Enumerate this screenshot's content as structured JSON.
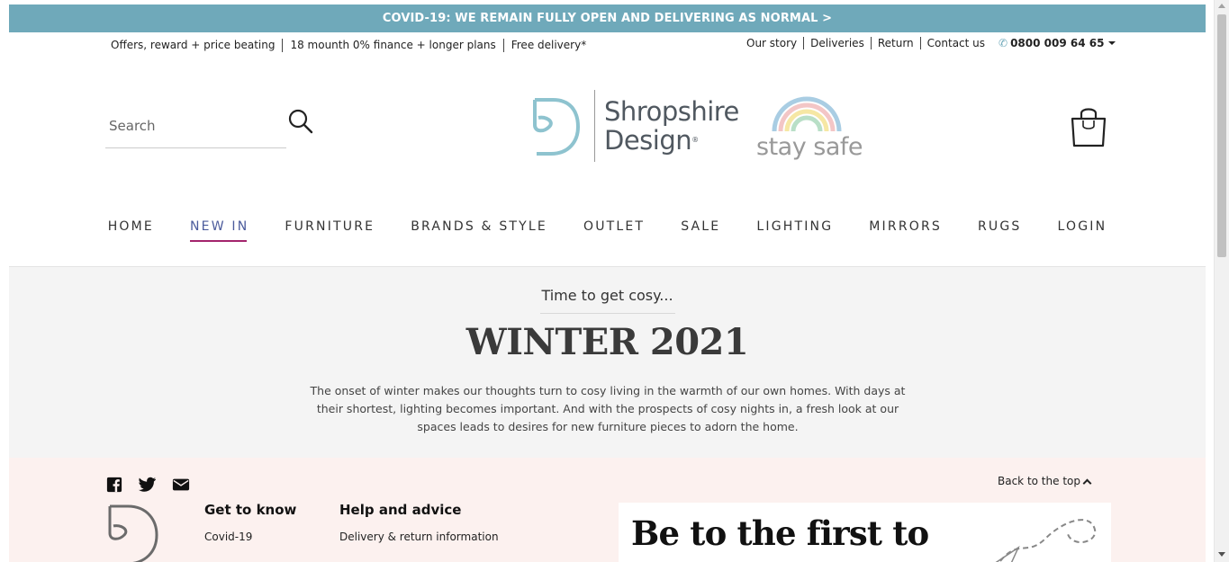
{
  "announcement": "COVID-19: WE REMAIN FULLY OPEN AND DELIVERING AS NORMAL >",
  "utility_left": [
    "Offers, reward + price beating",
    "18 mounth 0% finance + longer plans",
    "Free delivery*"
  ],
  "utility_right": [
    "Our story",
    "Deliveries",
    "Return",
    "Contact us"
  ],
  "phone": "0800 009 64 65",
  "search": {
    "placeholder": "Search"
  },
  "logo": {
    "line1": "Shropshire",
    "line2": "Design",
    "reg": "®"
  },
  "stay_safe": "stay safe",
  "nav": [
    {
      "label": "HOME"
    },
    {
      "label": "NEW IN"
    },
    {
      "label": "FURNITURE"
    },
    {
      "label": "BRANDS & STYLE"
    },
    {
      "label": "OUTLET"
    },
    {
      "label": "SALE"
    },
    {
      "label": "LIGHTING"
    },
    {
      "label": "MIRRORS"
    },
    {
      "label": "RUGS"
    },
    {
      "label": "LOGIN"
    }
  ],
  "hero": {
    "kicker": "Time to get cosy...",
    "title": "WINTER 2021",
    "body": "The onset of winter makes our thoughts turn to cosy living in the warmth of our own homes. With days at their shortest, lighting becomes important. And with the prospects of cosy nights in, a fresh look at our spaces leads to desires for new furniture pieces to adorn the home."
  },
  "footer": {
    "back_to_top": "Back to the top",
    "col1": {
      "heading": "Get to know",
      "item": "Covid-19"
    },
    "col2": {
      "heading": "Help and advice",
      "item": "Delivery & return information"
    },
    "promo_title": "Be to the first to"
  },
  "colors": {
    "brand_teal": "#6fa9ba",
    "nav_active": "#4b5b9c",
    "nav_underline": "#a3246c",
    "hero_bg": "#f4f4f4",
    "footer_bg": "#fcf1ef"
  }
}
